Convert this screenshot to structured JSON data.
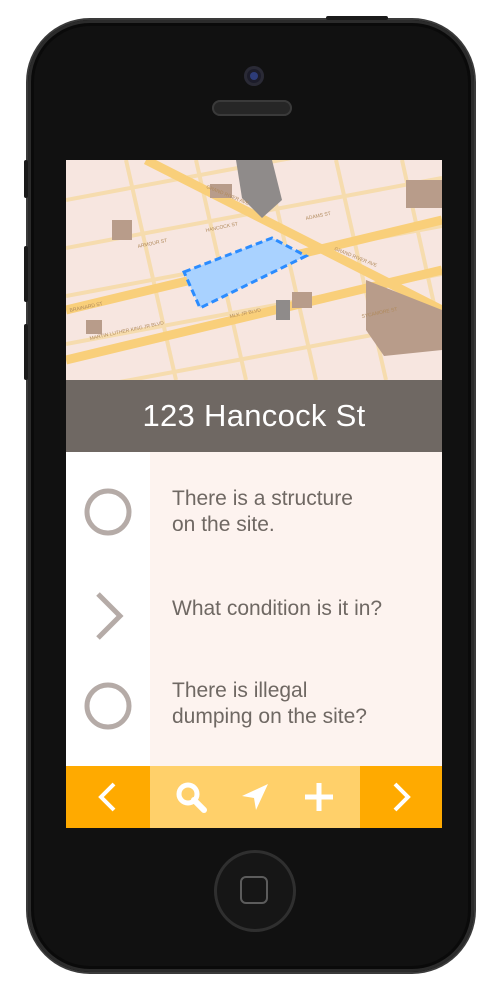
{
  "address": {
    "title": "123 Hancock St"
  },
  "map": {
    "street_labels": [
      "GRAND RIVER AVE",
      "ARMOUR ST",
      "BRAINARD ST",
      "MARTIN LUTHER KING JR BLVD",
      "GRAND RIVER AVE",
      "SYCAMORE ST",
      "MLK JR BLVD",
      "HANCOCK ST",
      "ADAMS ST"
    ]
  },
  "questions": [
    {
      "text_line1": "There is a structure",
      "text_line2": "on the site.",
      "icon": "circle-icon"
    },
    {
      "text_line1": "What condition is it in?",
      "text_line2": "",
      "icon": "chevron-right-icon"
    },
    {
      "text_line1": "There is illegal",
      "text_line2": "dumping on the site?",
      "icon": "circle-icon"
    }
  ],
  "toolbar": {
    "prev_icon": "chevron-left-icon",
    "search_icon": "search-icon",
    "locate_icon": "location-arrow-icon",
    "add_icon": "plus-icon",
    "next_icon": "chevron-right-icon"
  },
  "colors": {
    "title_bar": "#6f6863",
    "nav_orange": "#ffaa00",
    "tools_yellow": "#ffd06a",
    "content_bg": "#fdf3ef",
    "text": "#6f6863",
    "parcel_fill": "#a9d2ff",
    "parcel_stroke": "#2b8cff"
  }
}
